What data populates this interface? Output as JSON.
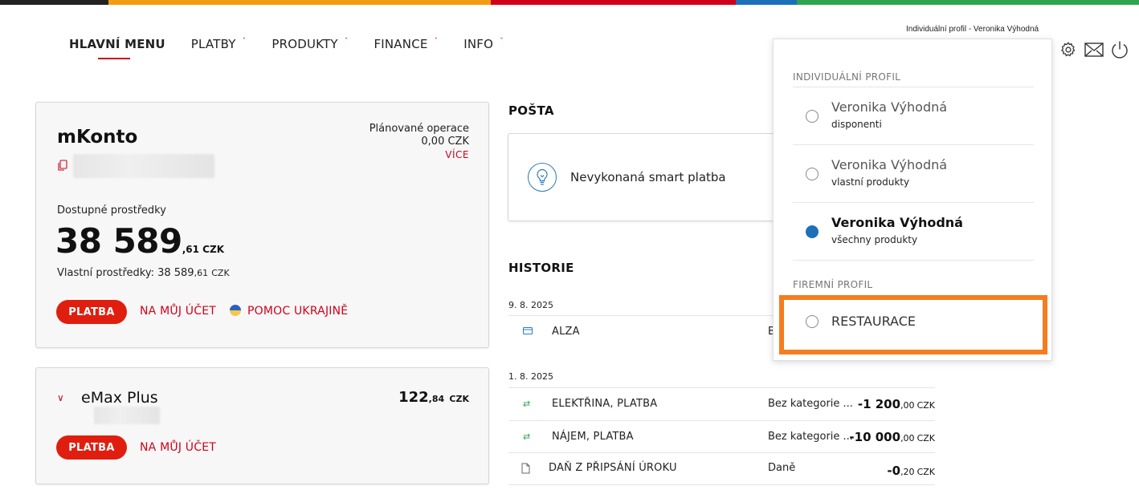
{
  "colors": {
    "accent_red": "#d0021b",
    "button_red": "#e01e0f",
    "selected_blue": "#1d6fb8",
    "highlight_orange": "#f57c20",
    "topbar": [
      "#222222",
      "#f39c12",
      "#d0021b",
      "#1d6fb8",
      "#2ea44f"
    ]
  },
  "nav": {
    "main": "HLAVNÍ MENU",
    "items": [
      {
        "label": "PLATBY",
        "icon": "chevron-down-icon"
      },
      {
        "label": "PRODUKTY",
        "icon": "chevron-down-icon"
      },
      {
        "label": "FINANCE",
        "icon": "chevron-down-icon"
      },
      {
        "label": "INFO",
        "icon": "chevron-down-icon"
      }
    ]
  },
  "header": {
    "profile_label": "Individuální profil - Veronika Výhodná",
    "icons": [
      "settings-icon",
      "mail-icon",
      "power-icon"
    ]
  },
  "account_main": {
    "name": "mKonto",
    "planned_label": "Plánované operace",
    "planned_value": "0,00 CZK",
    "more_link": "VÍCE",
    "available_label": "Dostupné prostředky",
    "amount_int": "38 589",
    "amount_dec": ",61 CZK",
    "own_label": "Vlastní prostředky: 38 589",
    "own_dec": ",61",
    "own_currency": "CZK",
    "pay_button": "PLATBA",
    "to_my_account": "NA MŮJ ÚČET",
    "help_ukraine": "POMOC UKRAJINĚ"
  },
  "account_emax": {
    "name": "eMax Plus",
    "amount_int": "122",
    "amount_dec": ",84",
    "amount_currency": "CZK",
    "pay_button": "PLATBA",
    "to_my_account": "NA MŮJ ÚČET"
  },
  "mail": {
    "title": "POŠTA",
    "message": "Nevykonaná smart platba"
  },
  "history": {
    "title": "HISTORIE",
    "groups": [
      {
        "date": "9. 8. 2025",
        "rows": [
          {
            "icon": "card-icon",
            "name": "ALZA",
            "category": "B",
            "amount_int": "",
            "amount_dec": "",
            "currency": ""
          }
        ]
      },
      {
        "date": "1. 8. 2025",
        "rows": [
          {
            "icon": "transfer-icon",
            "name": "ELEKTŘINA, PLATBA",
            "category": "Bez kategorie ...",
            "amount_int": "-1 200",
            "amount_dec": ",00",
            "currency": "CZK"
          },
          {
            "icon": "transfer-icon",
            "name": "NÁJEM, PLATBA",
            "category": "Bez kategorie ...",
            "amount_int": "-10 000",
            "amount_dec": ",00",
            "currency": "CZK"
          },
          {
            "icon": "document-icon",
            "name": "DAŇ Z PŘIPSÁNÍ ÚROKU",
            "category": "Daně",
            "amount_int": "-0",
            "amount_dec": ",20",
            "currency": "CZK"
          }
        ]
      }
    ]
  },
  "profile_dropdown": {
    "individual_heading": "INDIVIDUÁLNÍ PROFIL",
    "options": [
      {
        "name": "Veronika Výhodná",
        "sub": "disponenti",
        "selected": false
      },
      {
        "name": "Veronika Výhodná",
        "sub": "vlastní produkty",
        "selected": false
      },
      {
        "name": "Veronika Výhodná",
        "sub": "všechny produkty",
        "selected": true
      }
    ],
    "company_heading": "FIREMNÍ PROFIL",
    "company_option": {
      "name": "RESTAURACE",
      "selected": false
    }
  }
}
